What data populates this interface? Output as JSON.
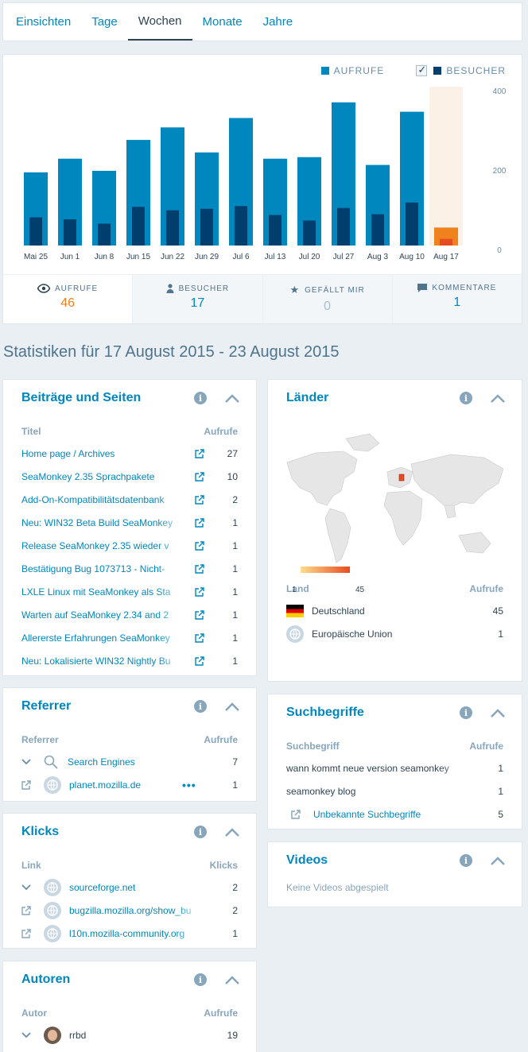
{
  "tabs": [
    "Einsichten",
    "Tage",
    "Wochen",
    "Monate",
    "Jahre"
  ],
  "active_tab": 2,
  "legend": {
    "views": "AUFRUFE",
    "visitors": "BESUCHER",
    "views_color": "#0087be",
    "visitors_color": "#003f6d"
  },
  "chart_data": {
    "type": "bar",
    "categories": [
      "Mai 25",
      "Jun 1",
      "Jun 8",
      "Jun 15",
      "Jun 22",
      "Jun 29",
      "Jul 6",
      "Jul 13",
      "Jul 20",
      "Jul 27",
      "Aug 3",
      "Aug 10",
      "Aug 17"
    ],
    "series": [
      {
        "name": "AUFRUFE",
        "values": [
          187,
          222,
          191,
          270,
          302,
          238,
          326,
          222,
          226,
          366,
          206,
          342,
          46
        ]
      },
      {
        "name": "BESUCHER",
        "values": [
          72,
          67,
          56,
          99,
          90,
          94,
          101,
          78,
          64,
          96,
          80,
          110,
          17
        ]
      }
    ],
    "yticks": [
      "400",
      "200",
      "0"
    ],
    "ylim": [
      0,
      390
    ],
    "highlight_index": 12,
    "highlight_colors": {
      "bg": "#fcf1e6",
      "views": "#f0821e",
      "visitors": "#e64c21"
    }
  },
  "stats": [
    {
      "label": "AUFRUFE",
      "value": "46",
      "icon": "eye-icon"
    },
    {
      "label": "BESUCHER",
      "value": "17",
      "icon": "person-icon"
    },
    {
      "label": "GEFÄLLT MIR",
      "value": "0",
      "icon": "star-icon"
    },
    {
      "label": "KOMMENTARE",
      "value": "1",
      "icon": "comment-icon"
    }
  ],
  "period_title": "Statistiken für 17 August 2015 - 23 August 2015",
  "posts": {
    "title": "Beiträge und Seiten",
    "col_title": "Titel",
    "col_views": "Aufrufe",
    "rows": [
      {
        "title": "Home page / Archives",
        "views": "27"
      },
      {
        "title": "SeaMonkey 2.35 Sprachpakete",
        "views": "10"
      },
      {
        "title": "Add-On-Kompatibilitätsdatenbank",
        "views": "2"
      },
      {
        "title": "Neu: WIN32 Beta Build SeaMonkey",
        "views": "1"
      },
      {
        "title": "Release SeaMonkey 2.35 wieder v",
        "views": "1"
      },
      {
        "title": "Bestätigung Bug 1073713 - Nicht-",
        "views": "1"
      },
      {
        "title": "LXLE Linux mit SeaMonkey als Sta",
        "views": "1"
      },
      {
        "title": "Warten auf SeaMonkey 2.34 and 2",
        "views": "1"
      },
      {
        "title": "Allererste Erfahrungen SeaMonkey",
        "views": "1"
      },
      {
        "title": "Neu: Lokalisierte WIN32 Nightly Bu",
        "views": "1"
      }
    ]
  },
  "referrer": {
    "title": "Referrer",
    "col_title": "Referrer",
    "col_views": "Aufrufe",
    "rows": [
      {
        "title": "Search Engines",
        "views": "7"
      },
      {
        "title": "planet.mozilla.de",
        "views": "1"
      }
    ]
  },
  "clicks": {
    "title": "Klicks",
    "col_title": "Link",
    "col_views": "Klicks",
    "rows": [
      {
        "title": "sourceforge.net",
        "views": "2"
      },
      {
        "title": "bugzilla.mozilla.org/show_bu",
        "views": "2"
      },
      {
        "title": "l10n.mozilla-community.org",
        "views": "1"
      }
    ]
  },
  "authors": {
    "title": "Autoren",
    "col_title": "Autor",
    "col_views": "Aufrufe",
    "rows": [
      {
        "title": "rrbd",
        "views": "19"
      }
    ]
  },
  "countries": {
    "title": "Länder",
    "col_title": "Land",
    "col_views": "Aufrufe",
    "scale_min": "1",
    "scale_max": "45",
    "rows": [
      {
        "title": "Deutschland",
        "views": "45"
      },
      {
        "title": "Europäische Union",
        "views": "1"
      }
    ]
  },
  "search": {
    "title": "Suchbegriffe",
    "col_title": "Suchbegriff",
    "col_views": "Aufrufe",
    "rows": [
      {
        "title": "wann kommt neue version seamonkey",
        "views": "1"
      },
      {
        "title": "seamonkey blog",
        "views": "1"
      },
      {
        "title": "Unbekannte Suchbegriffe",
        "views": "5"
      }
    ]
  },
  "videos": {
    "title": "Videos",
    "empty": "Keine Videos abgespielt"
  }
}
